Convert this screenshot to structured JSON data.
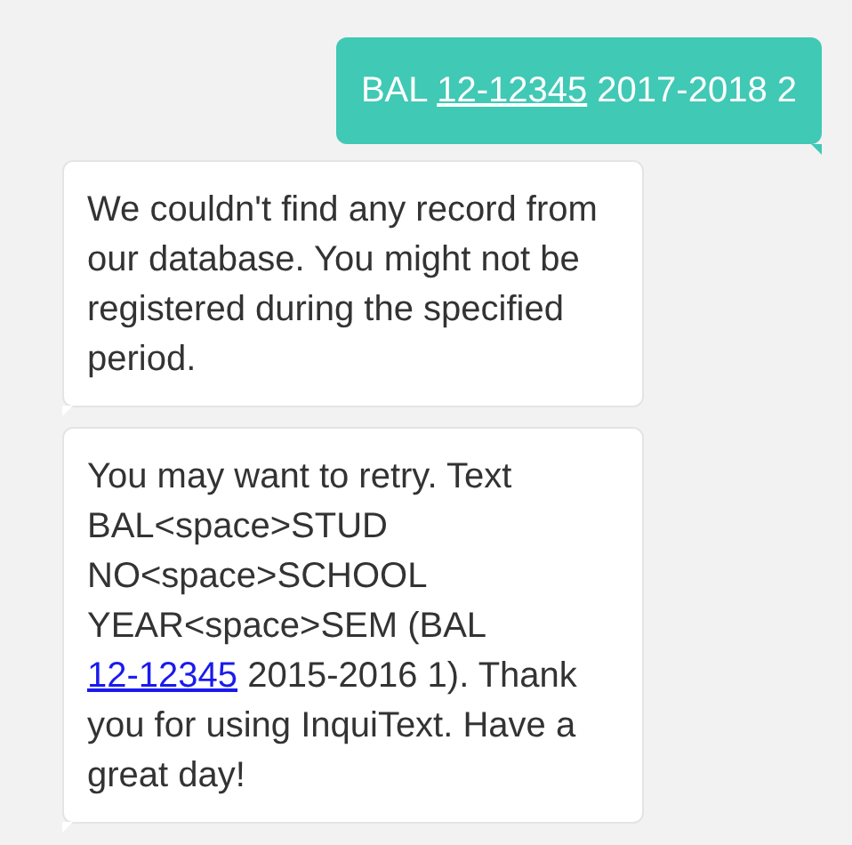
{
  "messages": [
    {
      "kind": "outgoing",
      "segments": [
        {
          "text": "BAL ",
          "kind": "text"
        },
        {
          "text": "12-12345",
          "kind": "link"
        },
        {
          "text": " 2017-2018 2",
          "kind": "text"
        }
      ]
    },
    {
      "kind": "incoming",
      "segments": [
        {
          "text": "We couldn't find any record from our database. You might not be registered during the specified period.",
          "kind": "text"
        }
      ]
    },
    {
      "kind": "incoming",
      "segments": [
        {
          "text": "You may want to retry. Text BAL<space>STUD NO<space>SCHOOL YEAR<space>SEM (BAL ",
          "kind": "text"
        },
        {
          "text": "12-12345",
          "kind": "link"
        },
        {
          "text": " 2015-2016 1). Thank you for using InquiText. Have a great day!",
          "kind": "text"
        }
      ]
    }
  ]
}
